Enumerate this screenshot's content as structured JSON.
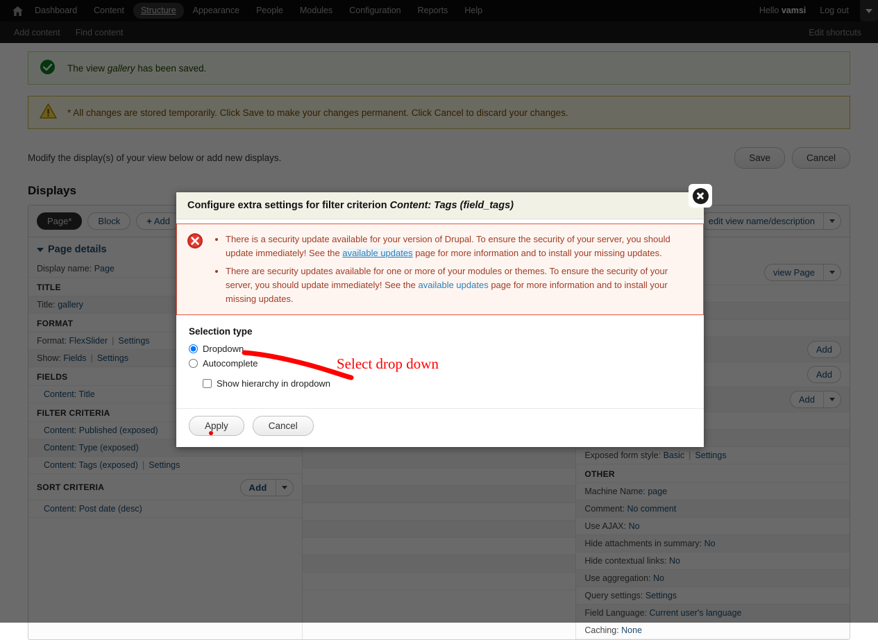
{
  "toolbar": {
    "home_icon": "home-icon",
    "items": [
      {
        "label": "Dashboard",
        "active": false
      },
      {
        "label": "Content",
        "active": false
      },
      {
        "label": "Structure",
        "active": true
      },
      {
        "label": "Appearance",
        "active": false
      },
      {
        "label": "People",
        "active": false
      },
      {
        "label": "Modules",
        "active": false
      },
      {
        "label": "Configuration",
        "active": false
      },
      {
        "label": "Reports",
        "active": false
      },
      {
        "label": "Help",
        "active": false
      }
    ],
    "greeting_prefix": "Hello ",
    "user": "vamsi",
    "logout": "Log out",
    "drawer_icon": "chevron-down-icon"
  },
  "shortcuts": {
    "add_content": "Add content",
    "find_content": "Find content",
    "edit_shortcuts": "Edit shortcuts"
  },
  "messages": {
    "status": {
      "icon": "check-circle-icon",
      "prefix": "The view ",
      "em": "gallery",
      "suffix": " has been saved."
    },
    "warning": {
      "icon": "warning-triangle-icon",
      "text": "* All changes are stored temporarily. Click Save to make your changes permanent. Click Cancel to discard your changes."
    }
  },
  "intro": {
    "text": "Modify the display(s) of your view below or add new displays.",
    "save_label": "Save",
    "cancel_label": "Cancel"
  },
  "displays": {
    "heading": "Displays",
    "tabs": [
      {
        "label": "Page*",
        "active": true
      },
      {
        "label": "Block",
        "active": false
      }
    ],
    "add_label": "Add",
    "add_plus": "+",
    "edit_view": "edit view name/description",
    "page_details": "Page details",
    "view_page": "view Page"
  },
  "left_column": [
    {
      "type": "row",
      "key": "Display name:",
      "value": "Page",
      "alt": false
    },
    {
      "type": "section",
      "label": "TITLE"
    },
    {
      "type": "row",
      "key": "Title:",
      "value": "gallery",
      "alt": true
    },
    {
      "type": "section",
      "label": "FORMAT"
    },
    {
      "type": "row2",
      "key": "Format:",
      "value": "FlexSlider",
      "value2": "Settings",
      "alt": false
    },
    {
      "type": "row2",
      "key": "Show:",
      "value": "Fields",
      "value2": "Settings",
      "alt": true
    },
    {
      "type": "section",
      "label": "FIELDS"
    },
    {
      "type": "item",
      "value": "Content: Title",
      "alt": false
    },
    {
      "type": "section",
      "label": "FILTER CRITERIA"
    },
    {
      "type": "item",
      "value": "Content: Published (exposed)",
      "alt": false
    },
    {
      "type": "item",
      "value": "Content: Type (exposed)",
      "alt": true
    },
    {
      "type": "item2",
      "value": "Content: Tags (exposed)",
      "value2": "Settings",
      "alt": false
    },
    {
      "type": "section",
      "label": "SORT CRITERIA",
      "button": "Add",
      "split": true
    },
    {
      "type": "item",
      "value": "Content: Post date (desc)",
      "alt": false
    }
  ],
  "right_column": [
    {
      "type": "blank",
      "alt": false
    },
    {
      "type": "blank",
      "alt": true
    },
    {
      "type": "blank",
      "alt": false
    },
    {
      "type": "button_row",
      "button": "Add",
      "alt": true
    },
    {
      "type": "button_row",
      "button": "Add",
      "alt": false
    },
    {
      "type": "button_row",
      "button": "Add",
      "split": true,
      "alt": true
    },
    {
      "type": "blank",
      "alt": false
    },
    {
      "type": "blank",
      "alt": true
    },
    {
      "type": "row2",
      "key": "Exposed form style:",
      "value": "Basic",
      "value2": "Settings",
      "alt": false
    },
    {
      "type": "section",
      "label": "OTHER"
    },
    {
      "type": "row",
      "key": "Machine Name:",
      "value": "page",
      "alt": false
    },
    {
      "type": "row",
      "key": "Comment:",
      "value": "No comment",
      "alt": true
    },
    {
      "type": "row",
      "key": "Use AJAX:",
      "value": "No",
      "alt": false
    },
    {
      "type": "row",
      "key": "Hide attachments in summary:",
      "value": "No",
      "alt": true
    },
    {
      "type": "row",
      "key": "Hide contextual links:",
      "value": "No",
      "alt": false
    },
    {
      "type": "row",
      "key": "Use aggregation:",
      "value": "No",
      "alt": true
    },
    {
      "type": "row",
      "key": "Query settings:",
      "value": "Settings",
      "alt": false
    },
    {
      "type": "row",
      "key": "Field Language:",
      "value": "Current user's language",
      "alt": true
    },
    {
      "type": "row",
      "key": "Caching:",
      "value": "None",
      "alt": false
    }
  ],
  "modal": {
    "title_prefix": "Configure extra settings for filter criterion ",
    "title_em": "Content: Tags (field_tags)",
    "close_icon": "close-icon",
    "error_icon": "error-circle-icon",
    "errors": [
      {
        "part1": "There is a security update available for your version of Drupal. To ensure the security of your server, you should update immediately! See the ",
        "link": "available updates",
        "part2": " page for more information and to install your missing updates.",
        "link_visited": true
      },
      {
        "part1": "There are security updates available for one or more of your modules or themes. To ensure the security of your server, you should update immediately! See the ",
        "link": "available updates",
        "part2": " page for more information and to install your missing updates.",
        "link_visited": false
      }
    ],
    "fieldset_title": "Selection type",
    "options": [
      {
        "label": "Dropdown",
        "checked": true
      },
      {
        "label": "Autocomplete",
        "checked": false
      }
    ],
    "checkbox": {
      "label": "Show hierarchy in dropdown",
      "checked": false
    },
    "apply_label": "Apply",
    "cancel_label": "Cancel"
  },
  "annotation": {
    "text": "Select drop down",
    "color": "#fe0000"
  }
}
